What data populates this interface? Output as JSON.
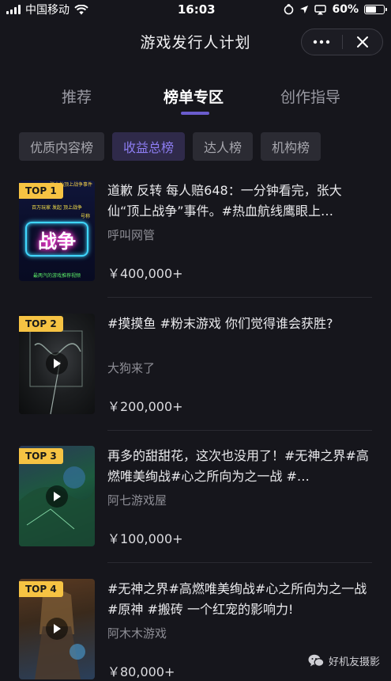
{
  "status": {
    "carrier": "中国移动",
    "time": "16:03",
    "battery": "60%",
    "battery_level": 0.6
  },
  "nav": {
    "title": "游戏发行人计划"
  },
  "tabs": [
    {
      "label": "推荐"
    },
    {
      "label": "榜单专区"
    },
    {
      "label": "创作指导"
    }
  ],
  "chips": [
    {
      "label": "优质内容榜"
    },
    {
      "label": "收益总榜"
    },
    {
      "label": "达人榜"
    },
    {
      "label": "机构榜"
    }
  ],
  "items": [
    {
      "rank": "TOP 1",
      "title": "道歉 反转 每人赔648：一分钟看完，张大仙“顶上战争”事件。#热血航线鹰眼上…",
      "author": "呼叫网管",
      "price": "￥400,000+",
      "thumb_text": {
        "top": "张大仙顶上战争事件",
        "line1": "百万玩家 发起 顶上战争",
        "line2": "号称",
        "big": "战争",
        "bottom": "最两汽的游戏推荐视频"
      }
    },
    {
      "rank": "TOP 2",
      "title": "#摸摸鱼 #粉末游戏 你们觉得谁会获胜?",
      "author": "大狗来了",
      "price": "￥200,000+"
    },
    {
      "rank": "TOP 3",
      "title": "再多的甜甜花，这次也没用了！#无神之界#高燃唯美绚战#心之所向为之一战 #…",
      "author": "阿七游戏屋",
      "price": "￥100,000+"
    },
    {
      "rank": "TOP 4",
      "title": "#无神之界#高燃唯美绚战#心之所向为之一战 #原神 #搬砖 一个红宠的影响力!",
      "author": "阿木木游戏",
      "price": "￥80,000+"
    }
  ],
  "watermark": "好机友摄影",
  "colors": {
    "accent": "#6a5ccd",
    "badge": "#f6c343",
    "background": "#16161c"
  }
}
